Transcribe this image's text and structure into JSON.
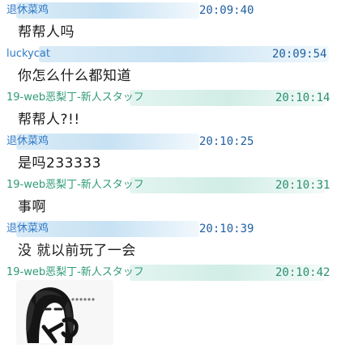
{
  "messages": [
    {
      "sender": "退休菜鸡",
      "time": "20:09:40",
      "text": "帮帮人吗",
      "color": "blue"
    },
    {
      "sender": "luckycat",
      "time": "20:09:54",
      "text": "你怎么什么都知道",
      "color": "blue"
    },
    {
      "sender": "19-web恶梨丁-新人スタッフ",
      "time": "20:10:14",
      "text": "帮帮人?!!",
      "color": "green"
    },
    {
      "sender": "退休菜鸡",
      "time": "20:10:25",
      "text": "是吗233333",
      "color": "blue"
    },
    {
      "sender": "19-web恶梨丁-新人スタッフ",
      "time": "20:10:31",
      "text": "事啊",
      "color": "green"
    },
    {
      "sender": "退休菜鸡",
      "time": "20:10:39",
      "text": "没 就以前玩了一会",
      "color": "blue"
    },
    {
      "sender": "19-web恶梨丁-新人スタッフ",
      "time": "20:10:42",
      "sticker": "anime-girl-sticker",
      "color": "green"
    }
  ],
  "colors": {
    "blue_sender": "#2f79c5",
    "green_sender": "#2f9a78",
    "message_text": "#1a1a1a"
  }
}
